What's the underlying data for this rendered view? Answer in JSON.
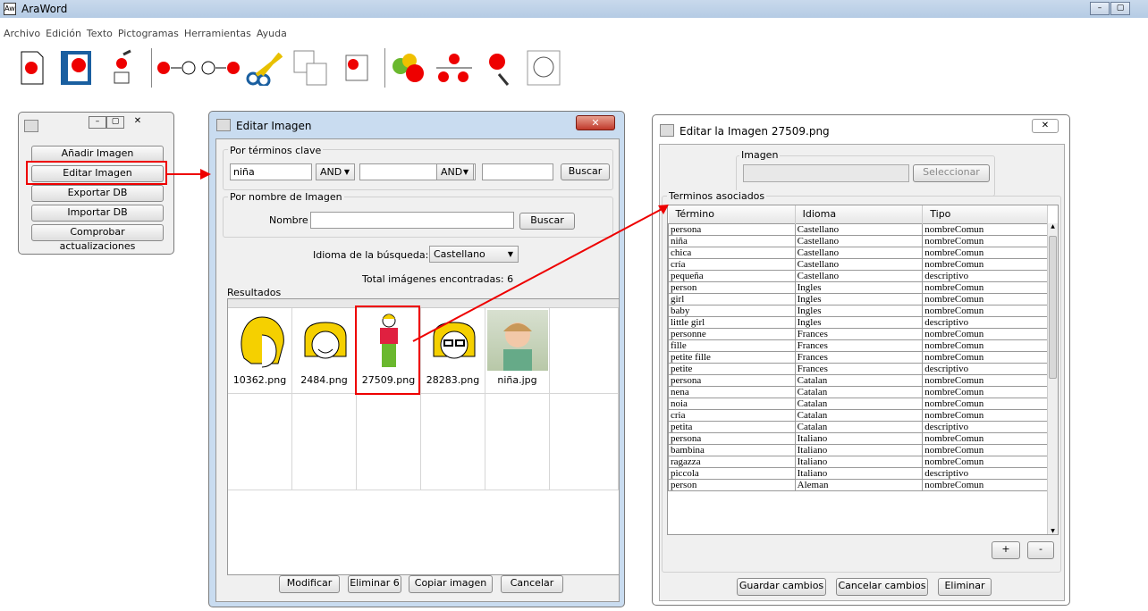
{
  "app": {
    "title": "AraWord"
  },
  "menu": [
    "Archivo",
    "Edición",
    "Texto",
    "Pictogramas",
    "Herramientas",
    "Ayuda"
  ],
  "toolbar": [
    "new-document",
    "open-document",
    "pictogram-hand",
    "link-left",
    "link-right",
    "cut",
    "copy-pictogram",
    "paste-pictogram",
    "change-pictogram",
    "pictogram-grid",
    "edit-pictogram",
    "face-pictogram"
  ],
  "smallwin": {
    "buttons": [
      "Añadir Imagen",
      "Editar Imagen",
      "Exportar DB",
      "Importar DB",
      "Comprobar actualizaciones"
    ]
  },
  "editar": {
    "title": "Editar Imagen",
    "keywords_group": "Por términos clave",
    "keyword1": "niña",
    "op1": "AND",
    "keyword2": "",
    "op2": "AND",
    "keyword3": "",
    "search1": "Buscar",
    "name_group": "Por nombre de Imagen",
    "name_label": "Nombre",
    "name_value": "",
    "search2": "Buscar",
    "lang_label": "Idioma de la búsqueda:",
    "lang_value": "Castellano",
    "total": "Total imágenes encontradas: 6",
    "results_label": "Resultados",
    "results": [
      "10362.png",
      "2484.png",
      "27509.png",
      "28283.png",
      "niña.jpg"
    ],
    "footer": [
      "Modificar",
      "Eliminar 6",
      "Copiar imagen",
      "Cancelar"
    ]
  },
  "editarla": {
    "title": "Editar la Imagen 27509.png",
    "image_label": "Imagen",
    "select_btn": "Seleccionar",
    "terms_label": "Terminos asociados",
    "headers": [
      "Término",
      "Idioma",
      "Tipo"
    ],
    "rows": [
      [
        "persona",
        "Castellano",
        "nombreComun"
      ],
      [
        "niña",
        "Castellano",
        "nombreComun"
      ],
      [
        "chica",
        "Castellano",
        "nombreComun"
      ],
      [
        "cría",
        "Castellano",
        "nombreComun"
      ],
      [
        "pequeña",
        "Castellano",
        "descriptivo"
      ],
      [
        "person",
        "Ingles",
        "nombreComun"
      ],
      [
        "girl",
        "Ingles",
        "nombreComun"
      ],
      [
        "baby",
        "Ingles",
        "nombreComun"
      ],
      [
        "little girl",
        "Ingles",
        "descriptivo"
      ],
      [
        "personne",
        "Frances",
        "nombreComun"
      ],
      [
        "fille",
        "Frances",
        "nombreComun"
      ],
      [
        "petite fille",
        "Frances",
        "nombreComun"
      ],
      [
        "petite",
        "Frances",
        "descriptivo"
      ],
      [
        "persona",
        "Catalan",
        "nombreComun"
      ],
      [
        "nena",
        "Catalan",
        "nombreComun"
      ],
      [
        "noia",
        "Catalan",
        "nombreComun"
      ],
      [
        "cria",
        "Catalan",
        "nombreComun"
      ],
      [
        "petita",
        "Catalan",
        "descriptivo"
      ],
      [
        "persona",
        "Italiano",
        "nombreComun"
      ],
      [
        "bambina",
        "Italiano",
        "nombreComun"
      ],
      [
        "ragazza",
        "Italiano",
        "nombreComun"
      ],
      [
        "piccola",
        "Italiano",
        "descriptivo"
      ],
      [
        "person",
        "Aleman",
        "nombreComun"
      ]
    ],
    "plus": "+",
    "minus": "-",
    "footer": [
      "Guardar cambios",
      "Cancelar cambios",
      "Eliminar"
    ]
  }
}
